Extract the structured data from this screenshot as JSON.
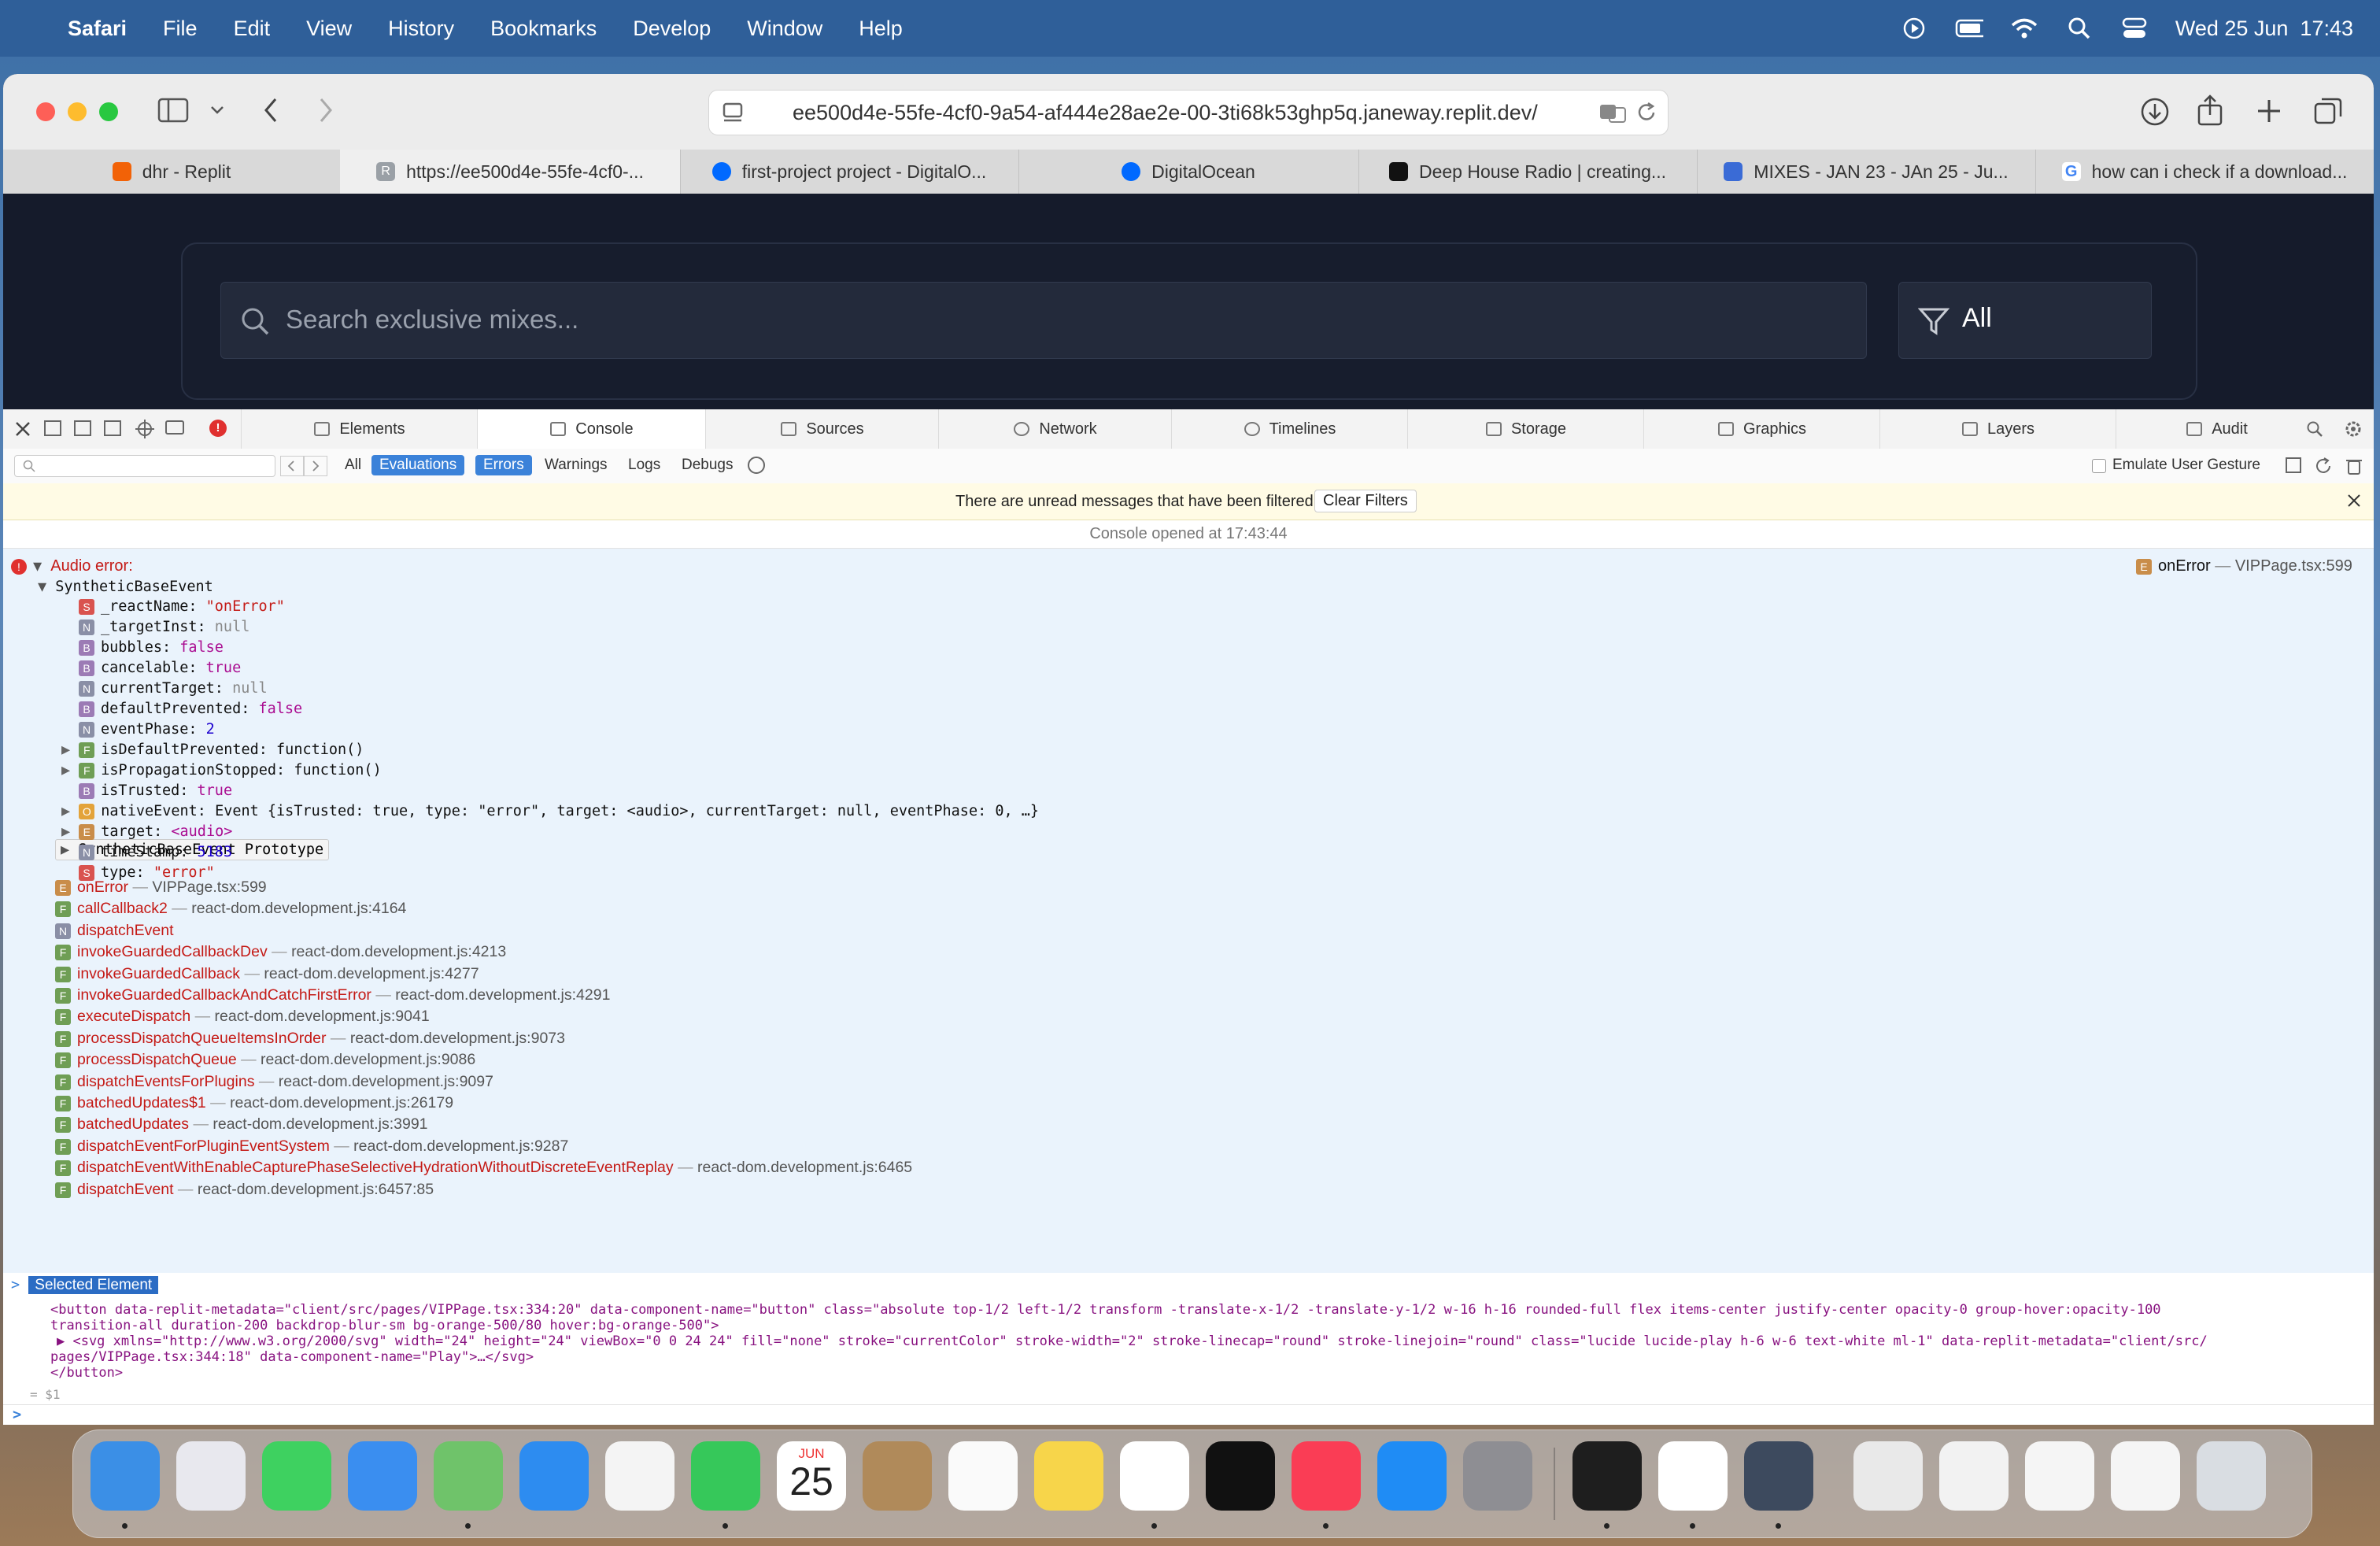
{
  "menubar": {
    "app_name": "Safari",
    "items": [
      "File",
      "Edit",
      "View",
      "History",
      "Bookmarks",
      "Develop",
      "Window",
      "Help"
    ],
    "clock": "Wed 25 Jun  17:43"
  },
  "browser": {
    "url": "ee500d4e-55fe-4cf0-9a54-af444e28ae2e-00-3ti68k53ghp5q.janeway.replit.dev/",
    "tabs": [
      {
        "label": "dhr - Replit",
        "favicon_color": "#f26207"
      },
      {
        "label": "https://ee500d4e-55fe-4cf0-...",
        "favicon_color": "#9aa0a6",
        "favicon_letter": "R"
      },
      {
        "label": "first-project project - DigitalO...",
        "favicon_color": "#0069ff"
      },
      {
        "label": "DigitalOcean",
        "favicon_color": "#0069ff"
      },
      {
        "label": "Deep House Radio | creating...",
        "favicon_color": "#111111"
      },
      {
        "label": "MIXES - JAN 23 - JAn 25 - Ju...",
        "favicon_color": "#3a6bd6"
      },
      {
        "label": "how can i check if a download...",
        "favicon_color": "#4285f4",
        "favicon_letter": "G"
      }
    ]
  },
  "page": {
    "search_placeholder": "Search exclusive mixes...",
    "filter_label": "All"
  },
  "devtools": {
    "tabs": [
      "Elements",
      "Console",
      "Sources",
      "Network",
      "Timelines",
      "Storage",
      "Graphics",
      "Layers",
      "Audit"
    ],
    "selected_tab": "Console",
    "filters": [
      "All",
      "Evaluations",
      "Errors",
      "Warnings",
      "Logs",
      "Debugs"
    ],
    "emulate_label": "Emulate User Gesture",
    "notice": "There are unread messages that have been filtered",
    "clear_filters": "Clear Filters",
    "console_opened": "Console opened at 17:43:44",
    "error_title": "Audio error:",
    "error_source_fn": "onError",
    "error_source_loc": "VIPPage.tsx:599",
    "event_class": "SyntheticBaseEvent",
    "props": [
      {
        "badge": "S",
        "key": "_reactName:",
        "val": "\"onError\"",
        "type": "vs"
      },
      {
        "badge": "N",
        "key": "_targetInst:",
        "val": "null",
        "type": "vnull"
      },
      {
        "badge": "B",
        "key": "bubbles:",
        "val": "false",
        "type": "vb"
      },
      {
        "badge": "B",
        "key": "cancelable:",
        "val": "true",
        "type": "vb"
      },
      {
        "badge": "N",
        "key": "currentTarget:",
        "val": "null",
        "type": "vnull"
      },
      {
        "badge": "B",
        "key": "defaultPrevented:",
        "val": "false",
        "type": "vb"
      },
      {
        "badge": "N",
        "key": "eventPhase:",
        "val": "2",
        "type": "vn"
      },
      {
        "badge": "F",
        "key": "isDefaultPrevented:",
        "val": "function()",
        "type": "kw",
        "expand": true
      },
      {
        "badge": "F",
        "key": "isPropagationStopped:",
        "val": "function()",
        "type": "kw",
        "expand": true
      },
      {
        "badge": "B",
        "key": "isTrusted:",
        "val": "true",
        "type": "vb"
      },
      {
        "badge": "O",
        "key": "nativeEvent:",
        "val": "Event {isTrusted: true, type: \"error\", target: <audio>, currentTarget: null, eventPhase: 0, …}",
        "type": "kw",
        "expand": true
      },
      {
        "badge": "E",
        "key": "target:",
        "val": "<audio>",
        "type": "vb",
        "expand": true
      },
      {
        "badge": "N",
        "key": "timeStamp:",
        "val": "5183",
        "type": "vn"
      },
      {
        "badge": "S",
        "key": "type:",
        "val": "\"error\"",
        "type": "vs"
      }
    ],
    "prototype_label": "SyntheticBaseEvent Prototype",
    "stack": [
      {
        "badge": "E",
        "fn": "onError",
        "loc": "VIPPage.tsx:599"
      },
      {
        "badge": "F",
        "fn": "callCallback2",
        "loc": "react-dom.development.js:4164"
      },
      {
        "badge": "N",
        "fn": "dispatchEvent",
        "loc": ""
      },
      {
        "badge": "F",
        "fn": "invokeGuardedCallbackDev",
        "loc": "react-dom.development.js:4213"
      },
      {
        "badge": "F",
        "fn": "invokeGuardedCallback",
        "loc": "react-dom.development.js:4277"
      },
      {
        "badge": "F",
        "fn": "invokeGuardedCallbackAndCatchFirstError",
        "loc": "react-dom.development.js:4291"
      },
      {
        "badge": "F",
        "fn": "executeDispatch",
        "loc": "react-dom.development.js:9041"
      },
      {
        "badge": "F",
        "fn": "processDispatchQueueItemsInOrder",
        "loc": "react-dom.development.js:9073"
      },
      {
        "badge": "F",
        "fn": "processDispatchQueue",
        "loc": "react-dom.development.js:9086"
      },
      {
        "badge": "F",
        "fn": "dispatchEventsForPlugins",
        "loc": "react-dom.development.js:9097"
      },
      {
        "badge": "F",
        "fn": "batchedUpdates$1",
        "loc": "react-dom.development.js:26179"
      },
      {
        "badge": "F",
        "fn": "batchedUpdates",
        "loc": "react-dom.development.js:3991"
      },
      {
        "badge": "F",
        "fn": "dispatchEventForPluginEventSystem",
        "loc": "react-dom.development.js:9287"
      },
      {
        "badge": "F",
        "fn": "dispatchEventWithEnableCapturePhaseSelectiveHydrationWithoutDiscreteEventReplay",
        "loc": "react-dom.development.js:6465"
      },
      {
        "badge": "F",
        "fn": "dispatchEvent",
        "loc": "react-dom.development.js:6457:85"
      }
    ],
    "selected_element_label": "Selected Element",
    "html_lines": [
      "<button data-replit-metadata=\"client/src/pages/VIPPage.tsx:334:20\" data-component-name=\"button\" class=\"absolute top-1/2 left-1/2 transform -translate-x-1/2 -translate-y-1/2 w-16 h-16 rounded-full flex items-center justify-center opacity-0 group-hover:opacity-100",
      "transition-all duration-200 backdrop-blur-sm bg-orange-500/80 hover:bg-orange-500\">",
      "▶ <svg xmlns=\"http://www.w3.org/2000/svg\" width=\"24\" height=\"24\" viewBox=\"0 0 24 24\" fill=\"none\" stroke=\"currentColor\" stroke-width=\"2\" stroke-linecap=\"round\" stroke-linejoin=\"round\" class=\"lucide lucide-play h-6 w-6 text-white ml-1\" data-replit-metadata=\"client/src/",
      "pages/VIPPage.tsx:344:18\" data-component-name=\"Play\">…</svg>",
      "</button>"
    ],
    "result_ref": "= $1"
  },
  "dock": {
    "calendar_month": "JUN",
    "calendar_day": "25",
    "apps": [
      {
        "name": "finder",
        "color": "#3b8fe6"
      },
      {
        "name": "launchpad",
        "color": "#e8e8ee"
      },
      {
        "name": "messages",
        "color": "#3ed160"
      },
      {
        "name": "mail",
        "color": "#3a8ef0"
      },
      {
        "name": "maps",
        "color": "#6fc36a"
      },
      {
        "name": "safari",
        "color": "#2d8cf0"
      },
      {
        "name": "photos",
        "color": "#f4f4f4"
      },
      {
        "name": "facetime",
        "color": "#36c85a"
      },
      {
        "name": "calendar",
        "color": "#ffffff"
      },
      {
        "name": "contacts",
        "color": "#b08a5a"
      },
      {
        "name": "reminders",
        "color": "#fafafa"
      },
      {
        "name": "notes",
        "color": "#f7d54a"
      },
      {
        "name": "freeform",
        "color": "#ffffff"
      },
      {
        "name": "apple-tv",
        "color": "#111111"
      },
      {
        "name": "music",
        "color": "#fa3d55"
      },
      {
        "name": "app-store",
        "color": "#1f8cf5"
      },
      {
        "name": "system-settings",
        "color": "#8e8e93"
      },
      {
        "name": "terminal",
        "color": "#1e1e1e"
      },
      {
        "name": "chrome",
        "color": "#ffffff"
      },
      {
        "name": "quicktime",
        "color": "#3d4a5e"
      },
      {
        "name": "audio-file",
        "color": "#e9e9e9"
      },
      {
        "name": "webp-file",
        "color": "#f2f2f2"
      },
      {
        "name": "screenshot-1",
        "color": "#f5f5f5"
      },
      {
        "name": "screenshot-2",
        "color": "#f5f5f5"
      },
      {
        "name": "trash",
        "color": "#d9dde2"
      }
    ]
  }
}
